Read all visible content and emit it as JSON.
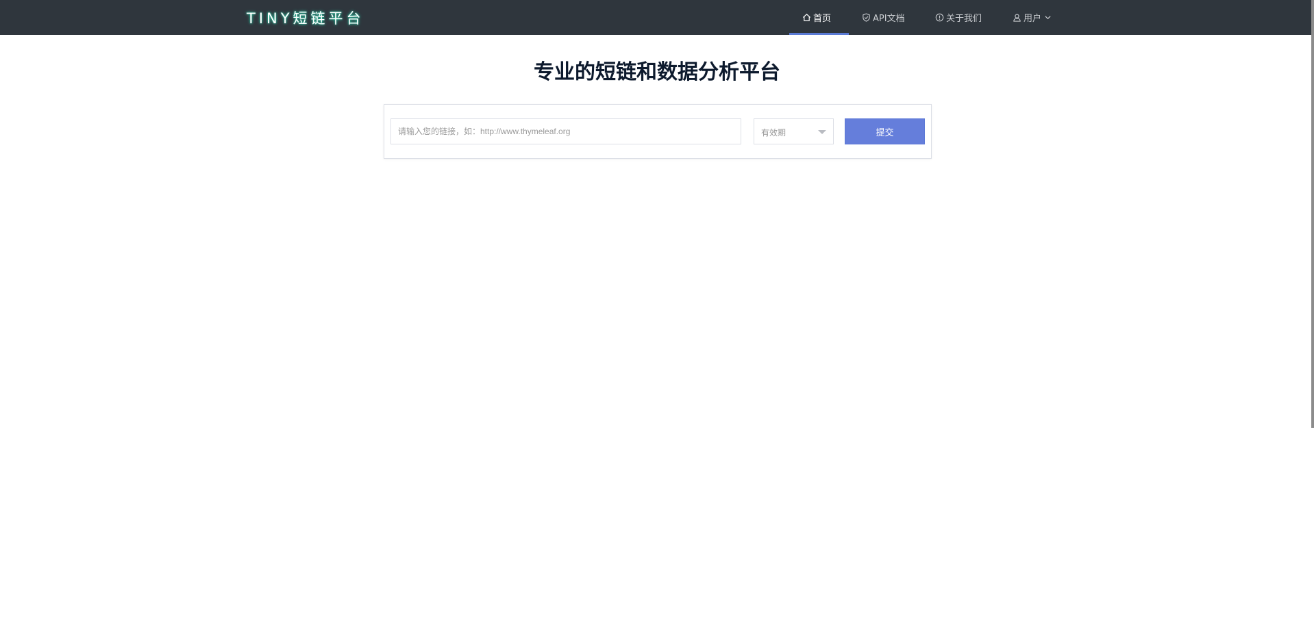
{
  "header": {
    "logo_text": "TINY短链平台",
    "nav": [
      {
        "label": "首页",
        "icon": "home-icon",
        "active": true
      },
      {
        "label": "API文档",
        "icon": "shield-check-icon",
        "active": false
      },
      {
        "label": "关于我们",
        "icon": "info-circle-icon",
        "active": false
      },
      {
        "label": "用户",
        "icon": "user-icon",
        "active": false,
        "dropdown_icon": "chevron-down-icon"
      }
    ]
  },
  "hero": {
    "title": "专业的短链和数据分析平台"
  },
  "form": {
    "url_placeholder": "请输入您的链接，如：http://www.thymeleaf.org",
    "url_value": "",
    "expiry_placeholder": "有效期",
    "submit_label": "提交"
  },
  "colors": {
    "header_bg": "#2f363d",
    "accent": "#657edb",
    "logo_glow": "#2fc9a6"
  }
}
